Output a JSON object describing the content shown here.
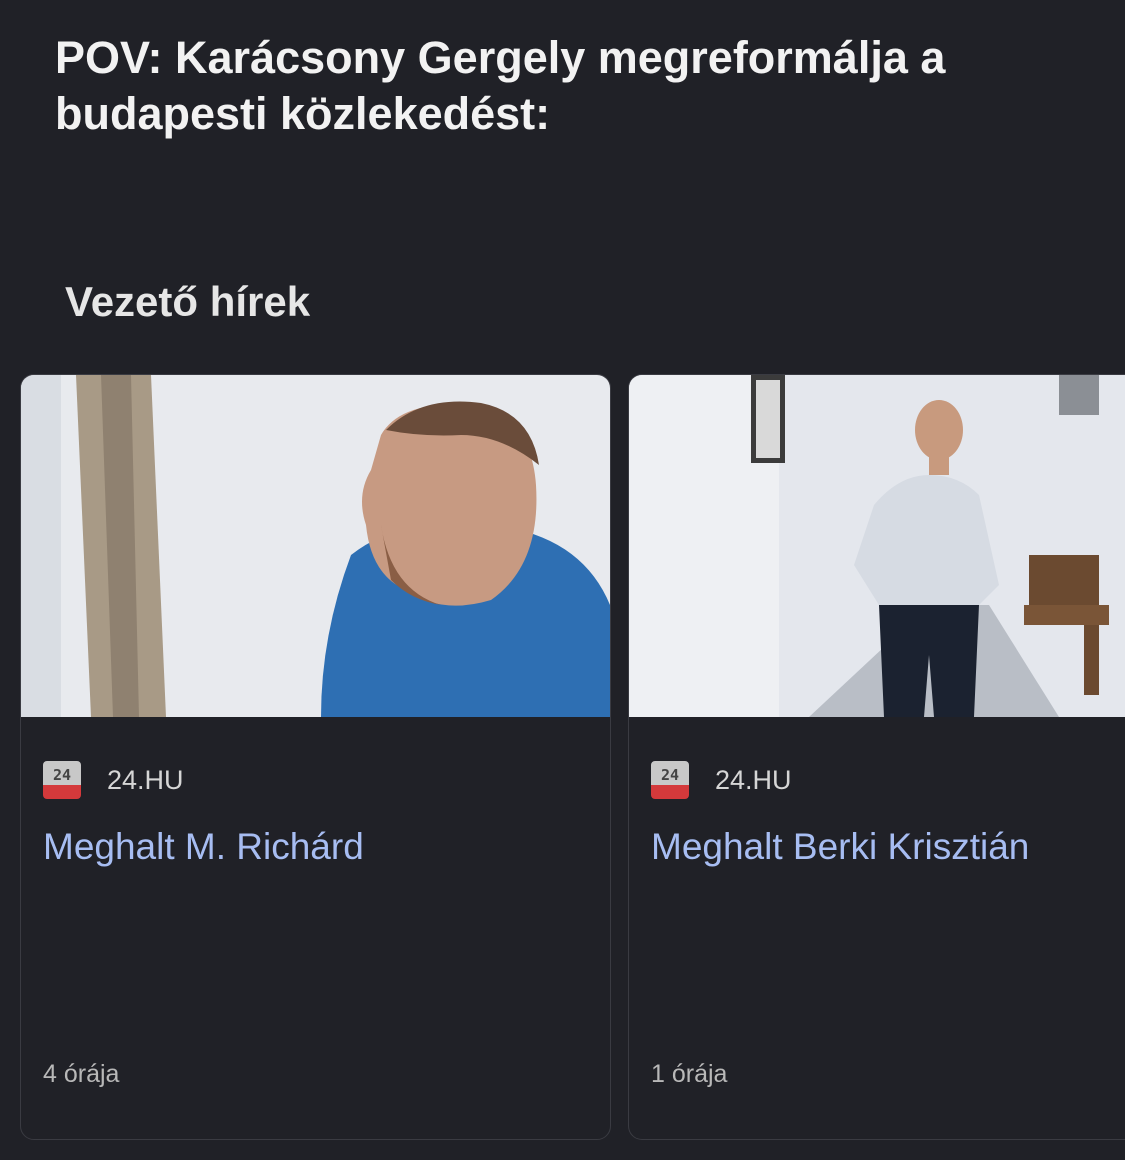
{
  "caption": "POV: Karácsony Gergely megreformálja a budapesti közlekedést:",
  "section_title": "Vezető hírek",
  "cards": [
    {
      "source": "24.HU",
      "headline": "Meghalt M. Richárd",
      "time": "4 órája"
    },
    {
      "source": "24.HU",
      "headline": "Meghalt Berki Krisztián",
      "time": "1 órája"
    }
  ],
  "colors": {
    "background": "#202127",
    "headline": "#a7bdf2",
    "logo_red": "#d4393b"
  }
}
